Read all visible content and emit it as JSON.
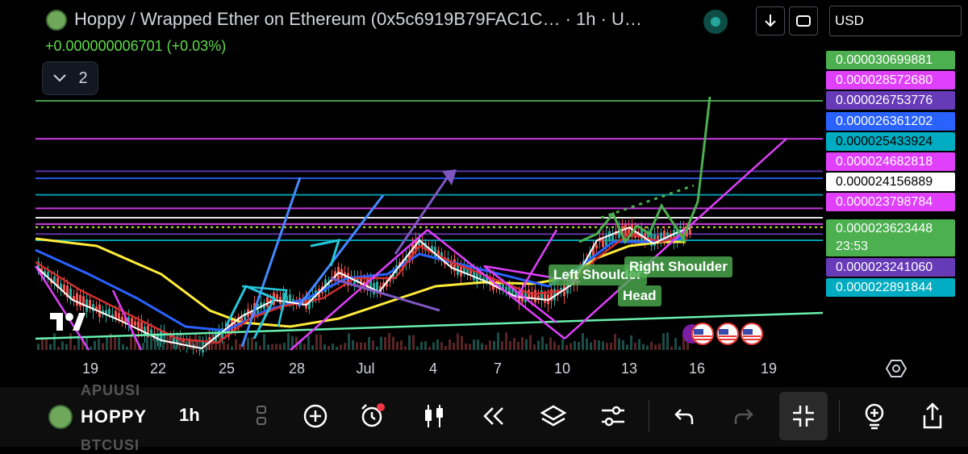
{
  "header": {
    "title": "Hoppy / Wrapped Ether on Ethereum (0x5c6919B79FAC1C… · 1h · U…",
    "change": "+0.000000006701 (+0.03%)",
    "indicator_count": "2",
    "currency": "USD"
  },
  "price_labels": [
    {
      "value": "0.000030699881",
      "bg": "#4caf50",
      "fg": "#ffffff"
    },
    {
      "value": "0.000028572680",
      "bg": "#e040fb",
      "fg": "#ffffff"
    },
    {
      "value": "0.000026753776",
      "bg": "#673ab7",
      "fg": "#ffffff"
    },
    {
      "value": "0.000026361202",
      "bg": "#2962ff",
      "fg": "#ffffff"
    },
    {
      "value": "0.000025433924",
      "bg": "#00acc1",
      "fg": "#000000"
    },
    {
      "value": "0.000024682818",
      "bg": "#e040fb",
      "fg": "#ffffff"
    },
    {
      "value": "0.000024156889",
      "bg": "#ffffff",
      "fg": "#000000"
    },
    {
      "value": "0.000023798784",
      "bg": "#e040fb",
      "fg": "#ffffff"
    },
    {
      "value": "0.000023623448",
      "countdown": "23:53",
      "bg": "#4caf50",
      "fg": "#ffffff"
    },
    {
      "value": "0.000023241060",
      "bg": "#673ab7",
      "fg": "#ffffff"
    },
    {
      "value": "0.000022891844",
      "bg": "#00acc1",
      "fg": "#ffffff"
    }
  ],
  "annotations": {
    "left_shoulder": "Left Shoulder",
    "head": "Head",
    "right_shoulder": "Right Shoulder"
  },
  "chart_data": {
    "type": "line",
    "title": "Hoppy / Wrapped Ether on Ethereum · 1h",
    "x_ticks": [
      "19",
      "22",
      "25",
      "28",
      "Jul",
      "4",
      "7",
      "10",
      "13",
      "16",
      "19"
    ],
    "y_unit": "USD",
    "current_price": 2.3623448e-05,
    "horizontal_levels": [
      {
        "price": 3.0699881e-05,
        "color": "#4caf50"
      },
      {
        "price": 2.857268e-05,
        "color": "#e040fb"
      },
      {
        "price": 2.6753776e-05,
        "color": "#673ab7"
      },
      {
        "price": 2.6361202e-05,
        "color": "#2962ff"
      },
      {
        "price": 2.5433924e-05,
        "color": "#00acc1"
      },
      {
        "price": 2.4682818e-05,
        "color": "#e040fb"
      },
      {
        "price": 2.4156889e-05,
        "color": "#ffffff"
      },
      {
        "price": 2.3798784e-05,
        "color": "#e040fb"
      },
      {
        "price": 2.324106e-05,
        "color": "#673ab7"
      },
      {
        "price": 2.2891844e-05,
        "color": "#00acc1"
      }
    ],
    "pattern": [
      "Left Shoulder",
      "Head",
      "Right Shoulder"
    ],
    "grid": false
  },
  "toolbar": {
    "symbol": "HOPPY",
    "symbol_prev": "APUUSI",
    "symbol_next": "BTCUSI",
    "timeframe": "1h"
  },
  "colors": {
    "background": "#000000",
    "up": "#26a69a",
    "down": "#ef5350",
    "ma_yellow": "#ffeb3b"
  }
}
